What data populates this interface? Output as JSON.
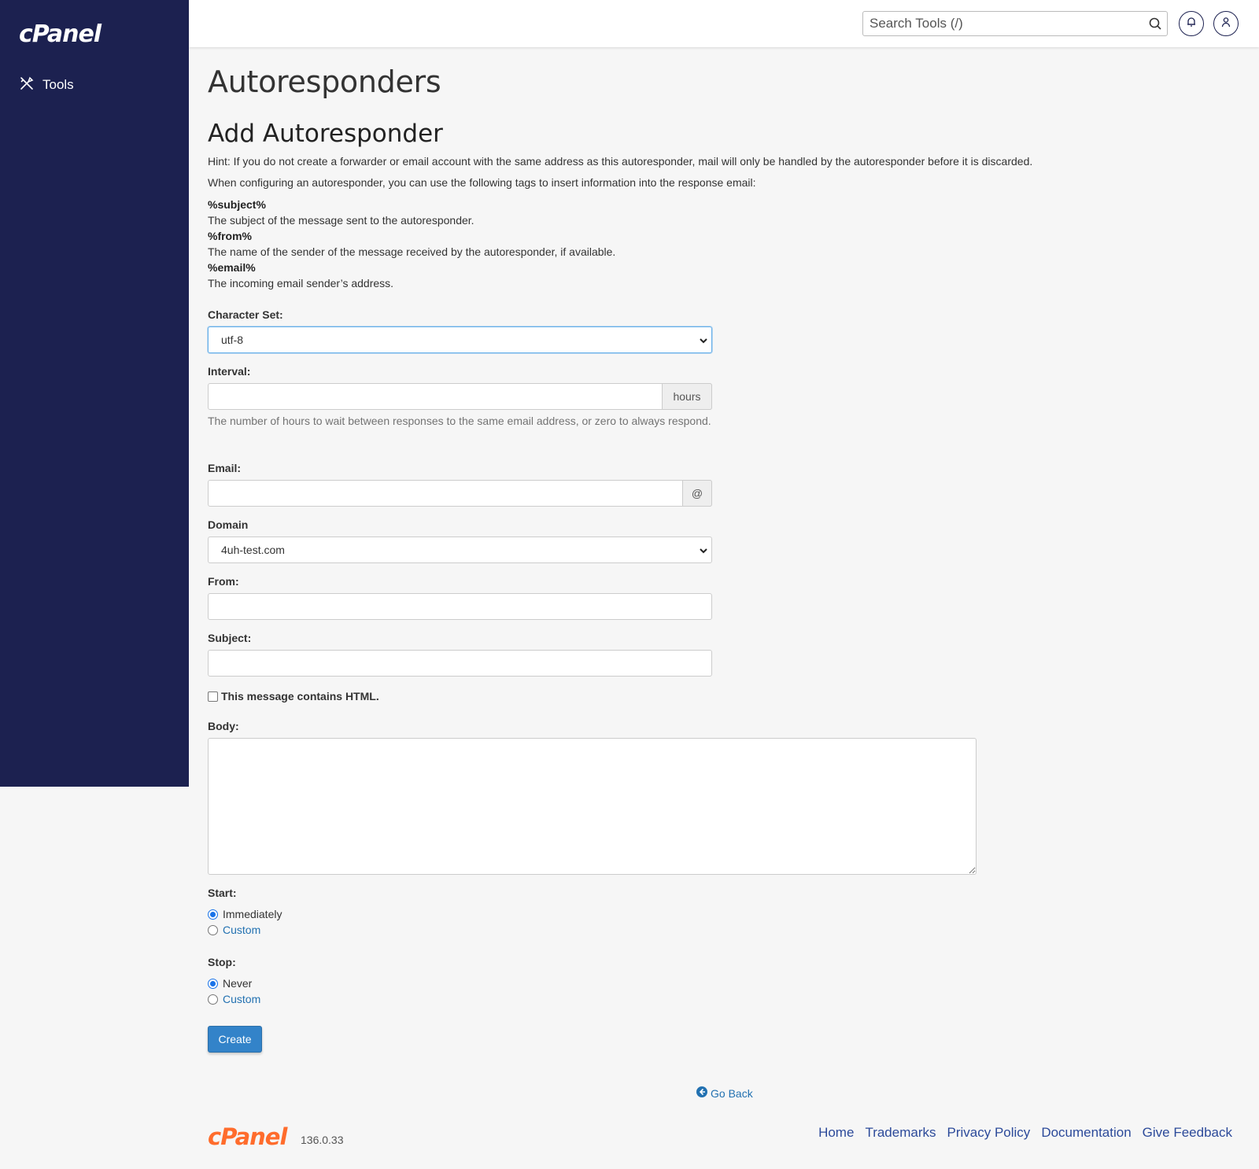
{
  "app": {
    "logo_text": "cPanel"
  },
  "sidebar": {
    "items": [
      {
        "label": "Tools",
        "icon": "tools-icon"
      }
    ]
  },
  "header": {
    "search_placeholder": "Search Tools (/)"
  },
  "page": {
    "title": "Autoresponders",
    "section_title": "Add Autoresponder",
    "hint": "Hint: If you do not create a forwarder or email account with the same address as this autoresponder, mail will only be handled by the autoresponder before it is discarded.",
    "tags_intro": "When configuring an autoresponder, you can use the following tags to insert information into the response email:",
    "tags": [
      {
        "tag": "%subject%",
        "desc": "The subject of the message sent to the autoresponder."
      },
      {
        "tag": "%from%",
        "desc": "The name of the sender of the message received by the autoresponder, if available."
      },
      {
        "tag": "%email%",
        "desc": "The incoming email sender’s address."
      }
    ]
  },
  "form": {
    "charset_label": "Character Set:",
    "charset_value": "utf-8",
    "interval_label": "Interval:",
    "interval_value": "",
    "interval_addon": "hours",
    "interval_help": "The number of hours to wait between responses to the same email address, or zero to always respond.",
    "email_label": "Email:",
    "email_value": "",
    "email_addon": "@",
    "domain_label": "Domain",
    "domain_value": "4uh-test.com",
    "from_label": "From:",
    "from_value": "",
    "subject_label": "Subject:",
    "subject_value": "",
    "html_checkbox_label": "This message contains HTML.",
    "html_checked": false,
    "body_label": "Body:",
    "body_value": "",
    "start_label": "Start:",
    "start_options": [
      {
        "label": "Immediately",
        "selected": true
      },
      {
        "label": "Custom",
        "selected": false
      }
    ],
    "stop_label": "Stop:",
    "stop_options": [
      {
        "label": "Never",
        "selected": true
      },
      {
        "label": "Custom",
        "selected": false
      }
    ],
    "create_button": "Create"
  },
  "footer": {
    "go_back": "Go Back",
    "logo_text": "cPanel",
    "version": "136.0.33",
    "links": [
      "Home",
      "Trademarks",
      "Privacy Policy",
      "Documentation",
      "Give Feedback"
    ]
  },
  "colors": {
    "sidebar_bg": "#1c2150",
    "primary_button": "#3383c9",
    "link": "#2271b1",
    "brand_orange": "#ff6c2c"
  }
}
